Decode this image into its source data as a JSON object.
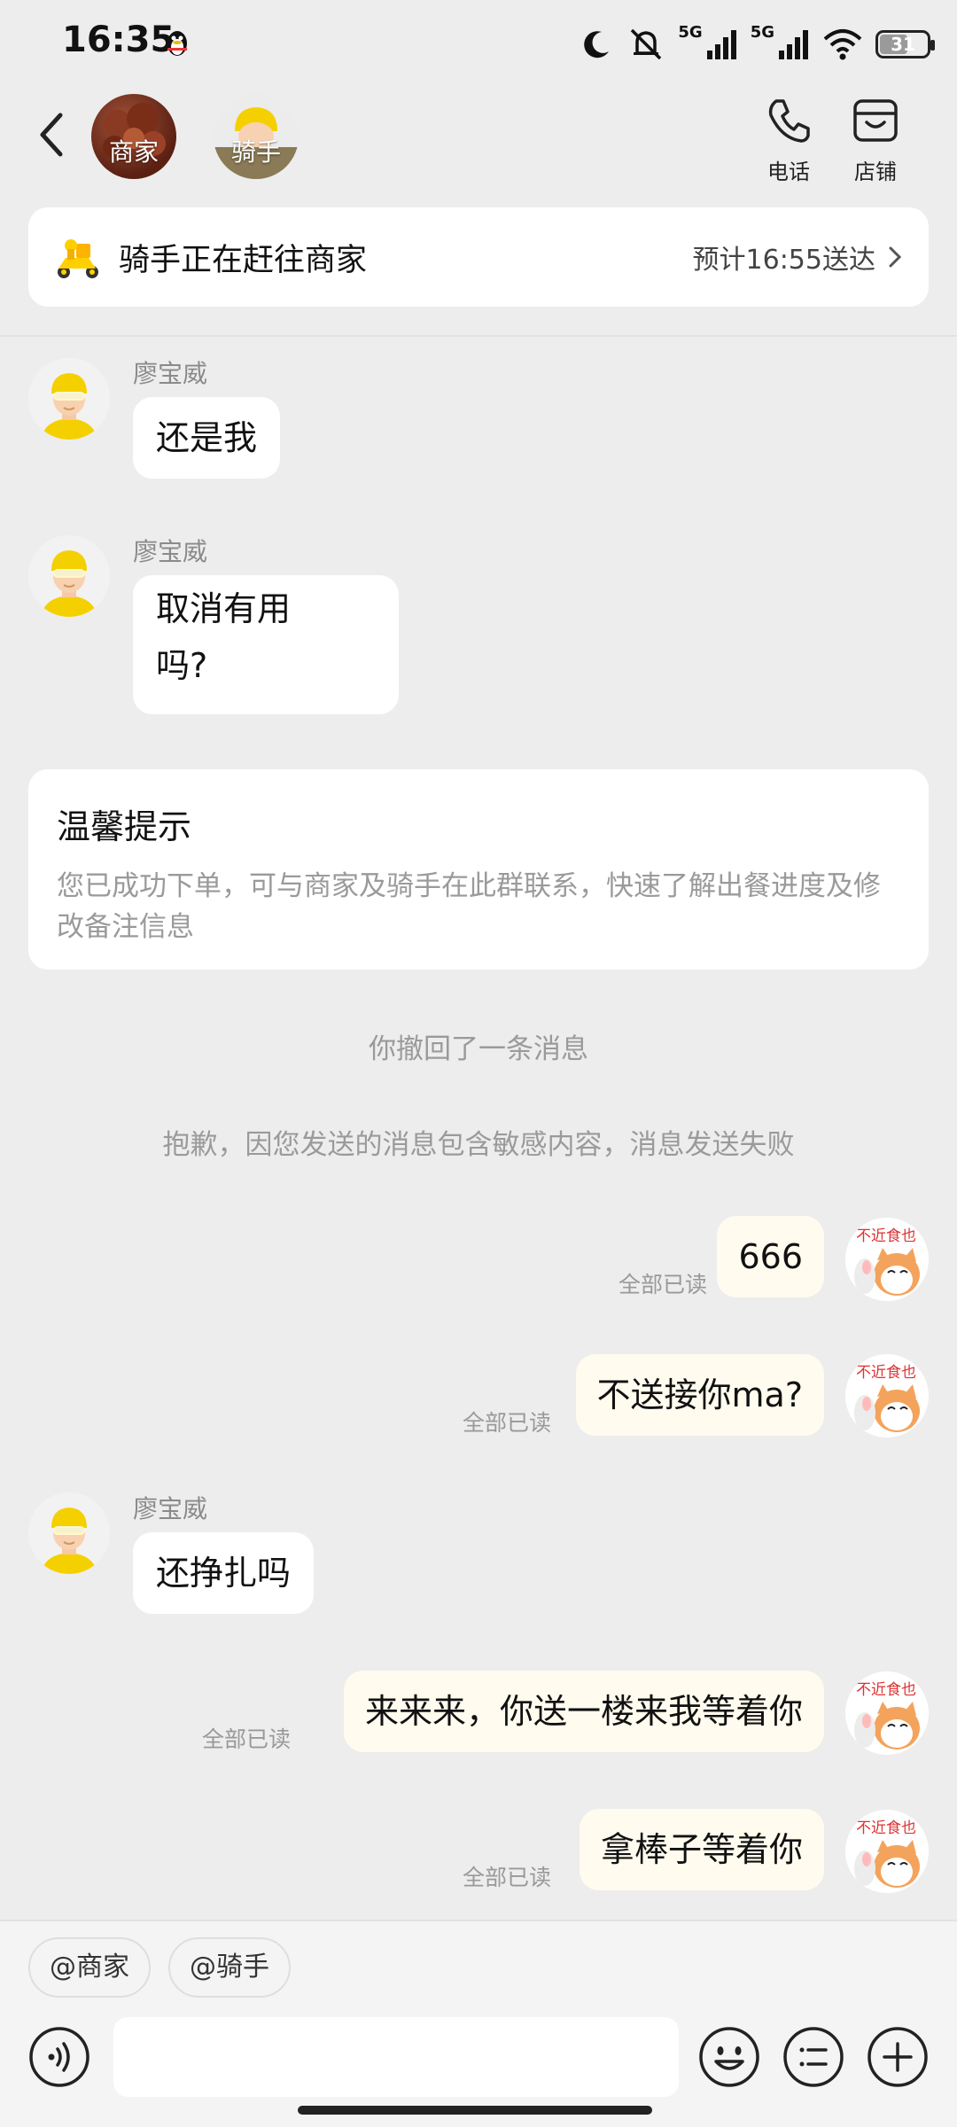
{
  "status_bar": {
    "time": "16:35",
    "network_1": "5G",
    "network_2": "5G",
    "battery": "31"
  },
  "header": {
    "avatars": [
      {
        "label": "商家"
      },
      {
        "label": "骑手"
      }
    ],
    "actions": [
      {
        "label": "电话",
        "icon": "phone-icon"
      },
      {
        "label": "店铺",
        "icon": "store-icon"
      }
    ]
  },
  "delivery_card": {
    "status": "骑手正在赶往商家",
    "eta": "预计16:55送达"
  },
  "messages": {
    "rider_name": "廖宝威",
    "m1": "还是我",
    "m2_line1": "取消有用",
    "m2_line2": "吗?",
    "tip_title": "温馨提示",
    "tip_body": "您已成功下单，可与商家及骑手在此群联系，快速了解出餐进度及修改备注信息",
    "recall_notice": "你撤回了一条消息",
    "fail_notice": "抱歉，因您发送的消息包含敏感内容，消息发送失败",
    "read_label": "全部已读",
    "me1": "666",
    "me2": "不送接你ma?",
    "m3": "还挣扎吗",
    "me3": "来来来，你送一楼来我等着你",
    "me4": "拿棒子等着你"
  },
  "bottom": {
    "chips": [
      "@商家",
      "@骑手"
    ]
  },
  "colors": {
    "page_bg": "#ededed",
    "my_bubble": "#fffbef",
    "rider_yellow": "#f5d000"
  }
}
